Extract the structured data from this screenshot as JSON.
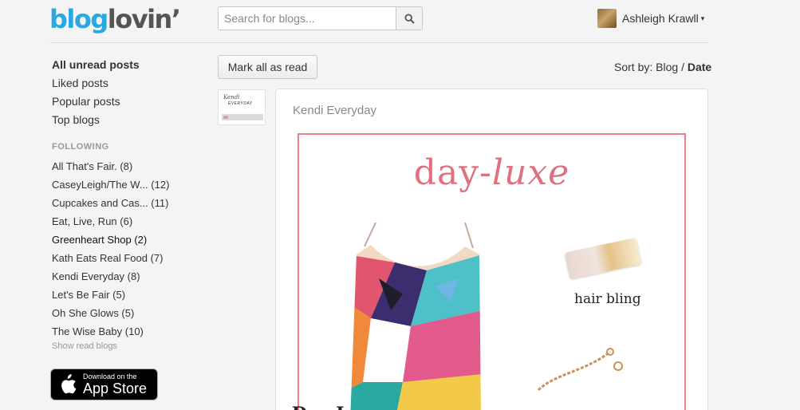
{
  "brand": {
    "part1": "blog",
    "part2": "lovin’"
  },
  "search": {
    "placeholder": "Search for blogs...",
    "button_icon": "search-icon"
  },
  "user": {
    "name": "Ashleigh Krawll",
    "caret": "▾"
  },
  "nav": {
    "items": [
      {
        "label": "All unread posts",
        "active": true
      },
      {
        "label": "Liked posts",
        "active": false
      },
      {
        "label": "Popular posts",
        "active": false
      },
      {
        "label": "Top blogs",
        "active": false
      }
    ]
  },
  "following": {
    "heading": "FOLLOWING",
    "blogs": [
      {
        "label": "All That's Fair. (8)"
      },
      {
        "label": "CaseyLeigh/The W... (12)"
      },
      {
        "label": "Cupcakes and Cas... (11)"
      },
      {
        "label": "Eat, Live, Run (6)"
      },
      {
        "label": "Greenheart Shop (2)"
      },
      {
        "label": "Kath Eats Real Food (7)"
      },
      {
        "label": "Kendi Everyday (8)"
      },
      {
        "label": "Let's Be Fair (5)"
      },
      {
        "label": "Oh She Glows (5)"
      },
      {
        "label": "The Wise Baby (10)"
      }
    ],
    "show_read": "Show read blogs"
  },
  "appstore": {
    "line1": "Download on the",
    "line2": "App Store"
  },
  "toolbar": {
    "mark_all_label": "Mark all as read",
    "sort_label": "Sort by:",
    "sort_blog": "Blog",
    "sort_sep": "/",
    "sort_date": "Date"
  },
  "post": {
    "source": "Kendi Everyday",
    "thumb_line1": "Kendi",
    "thumb_line2": "EVERYDAY",
    "image_title_part1": "day-",
    "image_title_part2": "luxe",
    "image_label": "hair bling",
    "title_partial": "Day-L"
  },
  "colors": {
    "brand_blue": "#2aa9e0",
    "accent_pink": "#e9808a"
  }
}
